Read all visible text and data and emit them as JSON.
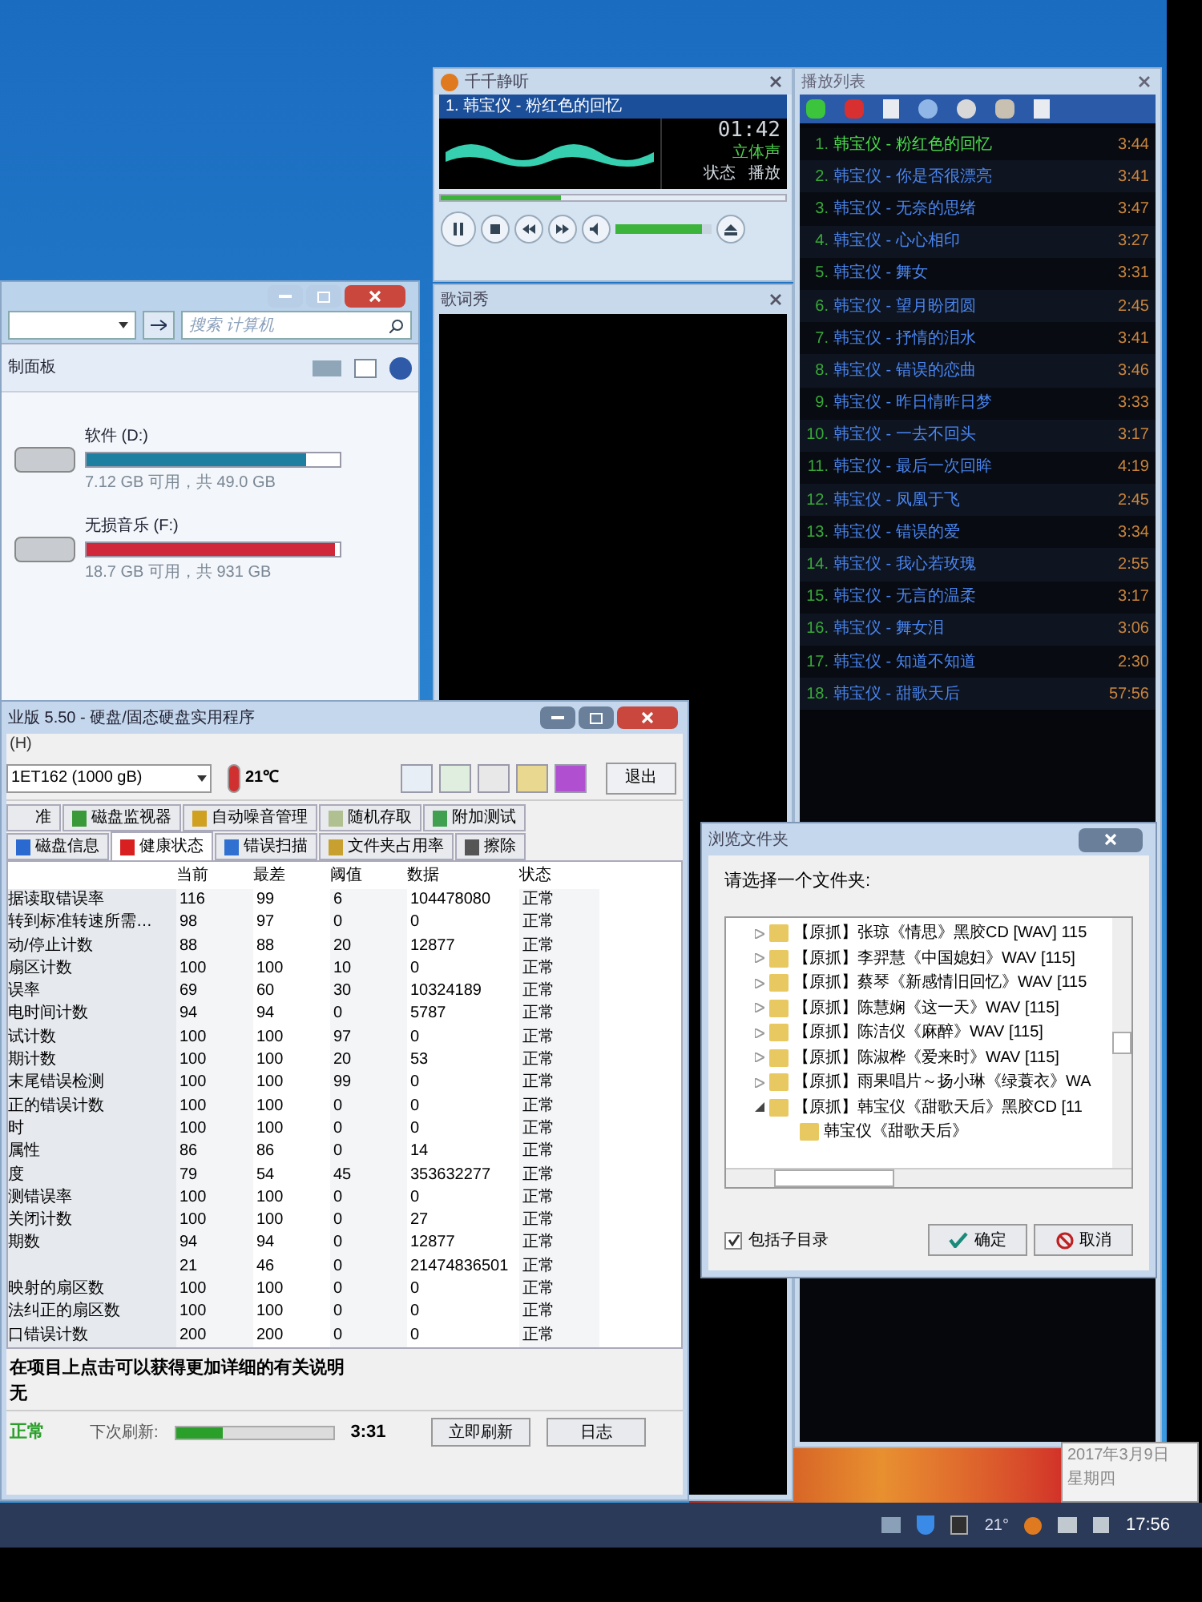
{
  "player": {
    "title": "千千静听",
    "track": "1. 韩宝仪 - 粉红色的回忆",
    "time": "01:42",
    "channel_mode": "立体声",
    "status_label": "状态",
    "status_value": "播放",
    "progress": {
      "level": 0.35
    },
    "volume": {
      "level": 0.9
    }
  },
  "lyrics": {
    "title": "歌词秀"
  },
  "playlist": {
    "title": "播放列表",
    "items": [
      {
        "number": "1.",
        "title": "韩宝仪 - 粉红色的回忆",
        "duration": "3:44",
        "playing": true
      },
      {
        "number": "2.",
        "title": "韩宝仪 - 你是否很漂亮",
        "duration": "3:41",
        "playing": false
      },
      {
        "number": "3.",
        "title": "韩宝仪 - 无奈的思绪",
        "duration": "3:47",
        "playing": false
      },
      {
        "number": "4.",
        "title": "韩宝仪 - 心心相印",
        "duration": "3:27",
        "playing": false
      },
      {
        "number": "5.",
        "title": "韩宝仪 - 舞女",
        "duration": "3:31",
        "playing": false
      },
      {
        "number": "6.",
        "title": "韩宝仪 - 望月盼团圆",
        "duration": "2:45",
        "playing": false
      },
      {
        "number": "7.",
        "title": "韩宝仪 - 抒情的泪水",
        "duration": "3:41",
        "playing": false
      },
      {
        "number": "8.",
        "title": "韩宝仪 - 错误的恋曲",
        "duration": "3:46",
        "playing": false
      },
      {
        "number": "9.",
        "title": "韩宝仪 - 昨日情昨日梦",
        "duration": "3:33",
        "playing": false
      },
      {
        "number": "10.",
        "title": "韩宝仪 - 一去不回头",
        "duration": "3:17",
        "playing": false
      },
      {
        "number": "11.",
        "title": "韩宝仪 - 最后一次回眸",
        "duration": "4:19",
        "playing": false
      },
      {
        "number": "12.",
        "title": "韩宝仪 - 凤凰于飞",
        "duration": "2:45",
        "playing": false
      },
      {
        "number": "13.",
        "title": "韩宝仪 - 错误的爱",
        "duration": "3:34",
        "playing": false
      },
      {
        "number": "14.",
        "title": "韩宝仪 - 我心若玫瑰",
        "duration": "2:55",
        "playing": false
      },
      {
        "number": "15.",
        "title": "韩宝仪 - 无言的温柔",
        "duration": "3:17",
        "playing": false
      },
      {
        "number": "16.",
        "title": "韩宝仪 - 舞女泪",
        "duration": "3:06",
        "playing": false
      },
      {
        "number": "17.",
        "title": "韩宝仪 - 知道不知道",
        "duration": "2:30",
        "playing": false
      },
      {
        "number": "18.",
        "title": "韩宝仪 - 甜歌天后",
        "duration": "57:56",
        "playing": false
      }
    ]
  },
  "explorer": {
    "search_placeholder": "搜索 计算机",
    "toolbar_label": "制面板",
    "drives": [
      {
        "name": "软件 (D:)",
        "space": "7.12 GB 可用，共 49.0 GB",
        "level": 0.87,
        "color": "#1e7fa0"
      },
      {
        "name": "无损音乐 (F:)",
        "space": "18.7 GB 可用，共 931 GB",
        "level": 0.98,
        "color": "#d0283a"
      }
    ]
  },
  "hdtune": {
    "title": "业版 5.50 - 硬盘/固态硬盘实用程序",
    "menu": "(H)",
    "drive": "1ET162 (1000 gB)",
    "temperature": "21℃",
    "exit_button": "退出",
    "tabs_row_1": [
      {
        "label": "准",
        "selected": false
      },
      {
        "label": "磁盘监视器",
        "selected": false
      },
      {
        "label": "自动噪音管理",
        "selected": false
      },
      {
        "label": "随机存取",
        "selected": false
      },
      {
        "label": "附加测试",
        "selected": false
      }
    ],
    "tabs_row_2": [
      {
        "label": "磁盘信息",
        "selected": false
      },
      {
        "label": "健康状态",
        "selected": true
      },
      {
        "label": "错误扫描",
        "selected": false
      },
      {
        "label": "文件夹占用率",
        "selected": false
      },
      {
        "label": "擦除",
        "selected": false
      }
    ],
    "columns": [
      "当前",
      "最差",
      "阈值",
      "数据",
      "状态"
    ],
    "rows": [
      {
        "attribute": "据读取错误率",
        "cells": [
          "116",
          "99",
          "6",
          "104478080",
          "正常"
        ]
      },
      {
        "attribute": "转到标准转速所需…",
        "cells": [
          "98",
          "97",
          "0",
          "0",
          "正常"
        ]
      },
      {
        "attribute": "动/停止计数",
        "cells": [
          "88",
          "88",
          "20",
          "12877",
          "正常"
        ]
      },
      {
        "attribute": "扇区计数",
        "cells": [
          "100",
          "100",
          "10",
          "0",
          "正常"
        ]
      },
      {
        "attribute": "误率",
        "cells": [
          "69",
          "60",
          "30",
          "10324189",
          "正常"
        ]
      },
      {
        "attribute": "电时间计数",
        "cells": [
          "94",
          "94",
          "0",
          "5787",
          "正常"
        ]
      },
      {
        "attribute": "试计数",
        "cells": [
          "100",
          "100",
          "97",
          "0",
          "正常"
        ]
      },
      {
        "attribute": "期计数",
        "cells": [
          "100",
          "100",
          "20",
          "53",
          "正常"
        ]
      },
      {
        "attribute": "末尾错误检测",
        "cells": [
          "100",
          "100",
          "99",
          "0",
          "正常"
        ]
      },
      {
        "attribute": "正的错误计数",
        "cells": [
          "100",
          "100",
          "0",
          "0",
          "正常"
        ]
      },
      {
        "attribute": "时",
        "cells": [
          "100",
          "100",
          "0",
          "0",
          "正常"
        ]
      },
      {
        "attribute": "属性",
        "cells": [
          "86",
          "86",
          "0",
          "14",
          "正常"
        ]
      },
      {
        "attribute": "度",
        "cells": [
          "79",
          "54",
          "45",
          "353632277",
          "正常"
        ]
      },
      {
        "attribute": "测错误率",
        "cells": [
          "100",
          "100",
          "0",
          "0",
          "正常"
        ]
      },
      {
        "attribute": "关闭计数",
        "cells": [
          "100",
          "100",
          "0",
          "27",
          "正常"
        ]
      },
      {
        "attribute": "期数",
        "cells": [
          "94",
          "94",
          "0",
          "12877",
          "正常"
        ]
      },
      {
        "cells": [
          "21",
          "46",
          "0",
          "21474836501",
          "正常"
        ]
      },
      {
        "attribute": "映射的扇区数",
        "cells": [
          "100",
          "100",
          "0",
          "0",
          "正常"
        ]
      },
      {
        "attribute": "法纠正的扇区数",
        "cells": [
          "100",
          "100",
          "0",
          "0",
          "正常"
        ]
      },
      {
        "attribute": "口错误计数",
        "cells": [
          "200",
          "200",
          "0",
          "0",
          "正常"
        ]
      }
    ],
    "info_title": "在项目上点击可以获得更加详细的有关说明",
    "info_text": "无",
    "health": "正常",
    "next_refresh_label": "下次刷新:",
    "refresh": {
      "level": 0.3
    },
    "countdown": "3:31",
    "refresh_button": "立即刷新",
    "log_button": "日志"
  },
  "dialog": {
    "title": "浏览文件夹",
    "prompt": "请选择一个文件夹:",
    "tree": [
      {
        "label": "【原抓】张琼《情思》黑胶CD [WAV] 115",
        "expanded": false
      },
      {
        "label": "【原抓】李羿慧《中国媳妇》WAV [115]",
        "expanded": false
      },
      {
        "label": "【原抓】蔡琴《新感情旧回忆》WAV [115",
        "expanded": false
      },
      {
        "label": "【原抓】陈慧娴《这一天》WAV [115]",
        "expanded": false
      },
      {
        "label": "【原抓】陈洁仪《麻醉》WAV [115]",
        "expanded": false
      },
      {
        "label": "【原抓】陈淑桦《爱来时》WAV [115]",
        "expanded": false
      },
      {
        "label": "【原抓】雨果唱片～扬小琳《绿蓑衣》WA",
        "expanded": false
      },
      {
        "label": "【原抓】韩宝仪《甜歌天后》黑胶CD [11",
        "expanded": true,
        "children": [
          {
            "label": "韩宝仪《甜歌天后》"
          }
        ]
      }
    ],
    "include_subfolders": {
      "label": "包括子目录",
      "checked": true
    },
    "ok_button": "确定",
    "cancel_button": "取消"
  },
  "taskbar": {
    "date": "2017年3月9日",
    "weekday": "星期四",
    "temperature": "21°",
    "clock": "17:56"
  }
}
